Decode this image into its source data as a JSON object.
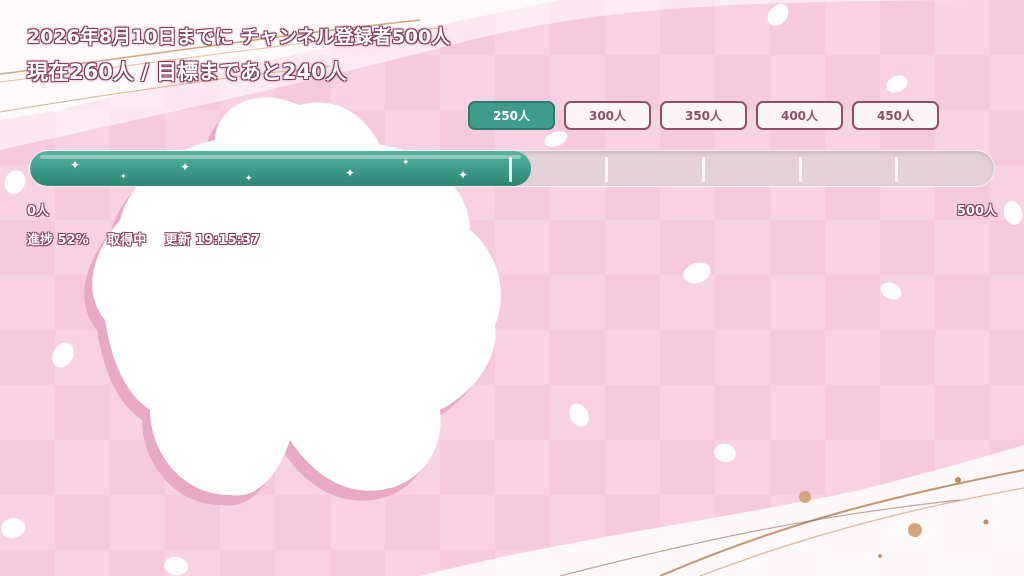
{
  "header": {
    "goal_text": "2026年8月10日までに チャンネル登録者500人",
    "current_text": "現在260人 / 目標まであと240人"
  },
  "milestones": [
    {
      "label": "250人",
      "reached": true
    },
    {
      "label": "300人",
      "reached": false
    },
    {
      "label": "350人",
      "reached": false
    },
    {
      "label": "400人",
      "reached": false
    },
    {
      "label": "450人",
      "reached": false
    }
  ],
  "progress": {
    "current": 260,
    "goal": 500,
    "fraction": 0.52
  },
  "axis": {
    "min_label": "0人",
    "max_label": "500人"
  },
  "status": {
    "progress": "進捗 52%",
    "state": "取得中",
    "updated": "更新 19:15:37"
  },
  "colors": {
    "fill": "#3d9a88",
    "accent": "#8e5068",
    "background": "#f7c9dd"
  }
}
